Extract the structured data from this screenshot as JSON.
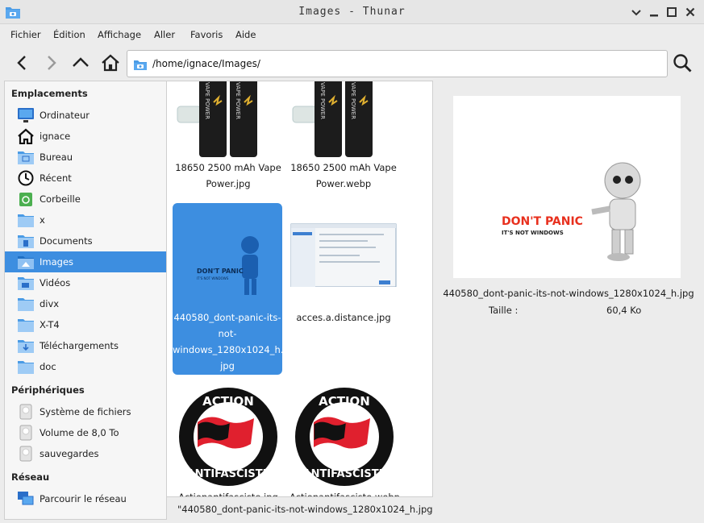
{
  "window": {
    "title": "Images - Thunar"
  },
  "menu": [
    "Fichier",
    "Édition",
    "Affichage",
    "Aller",
    "Favoris",
    "Aide"
  ],
  "location": {
    "path": "/home/ignace/Images/"
  },
  "sidebar": {
    "sections": {
      "places": "Emplacements",
      "devices": "Périphériques",
      "network": "Réseau"
    },
    "places": [
      {
        "label": "Ordinateur",
        "icon": "computer-icon"
      },
      {
        "label": "ignace",
        "icon": "home-icon"
      },
      {
        "label": "Bureau",
        "icon": "desktop-folder-icon"
      },
      {
        "label": "Récent",
        "icon": "clock-icon"
      },
      {
        "label": "Corbeille",
        "icon": "trash-icon"
      },
      {
        "label": "x",
        "icon": "folder-icon"
      },
      {
        "label": "Documents",
        "icon": "documents-folder-icon"
      },
      {
        "label": "Images",
        "icon": "pictures-folder-icon"
      },
      {
        "label": "Vidéos",
        "icon": "videos-folder-icon"
      },
      {
        "label": "divx",
        "icon": "folder-icon"
      },
      {
        "label": "X-T4",
        "icon": "folder-icon"
      },
      {
        "label": "Téléchargements",
        "icon": "downloads-folder-icon"
      },
      {
        "label": "doc",
        "icon": "folder-icon"
      }
    ],
    "devices": [
      {
        "label": "Système de fichiers",
        "icon": "drive-icon"
      },
      {
        "label": "Volume de 8,0 To",
        "icon": "drive-icon"
      },
      {
        "label": "sauvegardes",
        "icon": "drive-icon"
      }
    ],
    "network": [
      {
        "label": "Parcourir le réseau",
        "icon": "network-icon"
      }
    ]
  },
  "files": [
    {
      "name_line1": "18650 2500 mAh Vape",
      "name_line2": "Power.jpg"
    },
    {
      "name_line1": "18650 2500 mAh Vape",
      "name_line2": "Power.webp"
    },
    {
      "name_line1": "440580_dont-panic-its-",
      "name_line2": "not-",
      "name_line3": "windows_1280x1024_h.",
      "name_line4": "jpg"
    },
    {
      "name_line1": "acces.a.distance.jpg"
    },
    {
      "name_line1": "Actionantifasciste.jpg",
      "thumb_text_top": "ACTION",
      "thumb_text_bottom": "ANTIFASCISTE"
    },
    {
      "name_line1": "Actionantifasciste.webp",
      "thumb_text_top": "ACTION",
      "thumb_text_bottom": "ANTIFASCISTE"
    }
  ],
  "thumb_texts": {
    "vape_brand": "VAPE POWER",
    "panic_line1": "DON'T PANIC",
    "panic_line2": "IT'S NOT WINDOWS"
  },
  "status": {
    "text": "\"440580_dont-panic-its-not-windows_1280x1024_h.jpg\""
  },
  "preview": {
    "filename": "440580_dont-panic-its-not-windows_1280x1024_h.jpg",
    "size_label": "Taille :",
    "size_value": "60,4 Ko",
    "image_text1": "DON'T PANIC",
    "image_text2": "IT'S NOT WINDOWS"
  },
  "colors": {
    "selection": "#3d8ee0",
    "folder": "#4a9be5",
    "flag_red": "#e0202e"
  }
}
